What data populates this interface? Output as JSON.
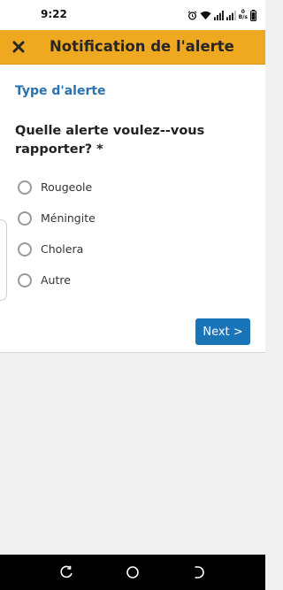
{
  "status_bar": {
    "time": "9:22",
    "net_speed_value": "0",
    "net_speed_unit": "B/s",
    "icons": [
      "alarm-icon",
      "wifi-icon",
      "signal-icon",
      "signal-icon",
      "battery-icon"
    ]
  },
  "app_bar": {
    "title": "Notification de l'alerte",
    "close_icon": "close-icon",
    "background": "#efa921"
  },
  "form": {
    "section_title": "Type d'alerte",
    "question": "Quelle alerte voulez--vous rapporter? *",
    "options": [
      {
        "label": "Rougeole",
        "selected": false
      },
      {
        "label": "Méningite",
        "selected": false
      },
      {
        "label": "Cholera",
        "selected": false
      },
      {
        "label": "Autre",
        "selected": false
      }
    ],
    "next_label": "Next >",
    "accent": "#1a75b8"
  },
  "nav_bar": {
    "buttons": [
      "back-icon",
      "home-icon",
      "recents-icon"
    ]
  }
}
